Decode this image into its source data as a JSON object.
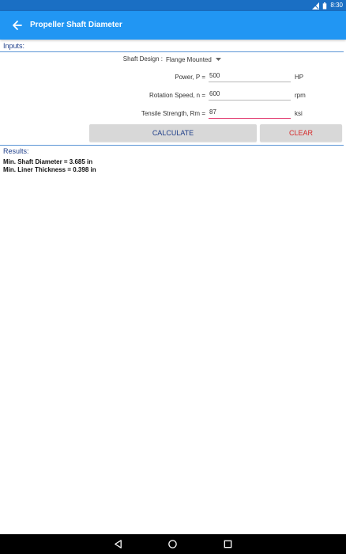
{
  "status": {
    "time": "8:30"
  },
  "appbar": {
    "title": "Propeller Shaft Diameter"
  },
  "inputs": {
    "label": "Inputs:",
    "shaft_design": {
      "label": "Shaft Design :",
      "value": "Flange Mounted"
    },
    "power": {
      "label": "Power, P =",
      "value": "500",
      "unit": "HP"
    },
    "rotation": {
      "label": "Rotation Speed, n =",
      "value": "600",
      "unit": "rpm"
    },
    "tensile": {
      "label": "Tensile Strength, Rm =",
      "value": "87",
      "unit": "ksi"
    }
  },
  "buttons": {
    "calculate": "CALCULATE",
    "clear": "CLEAR"
  },
  "results": {
    "label": "Results:",
    "line1": "Min. Shaft Diameter = 3.685 in",
    "line2": "Min. Liner Thickness = 0.398 in"
  },
  "colors": {
    "appbar": "#2196f3",
    "statusbar": "#1a6fc4",
    "accent": "#e0356b",
    "clear": "#d62a2a",
    "label": "#1f3f8a"
  },
  "icons": {
    "back": "arrow-back-icon",
    "dropdown": "dropdown-caret-icon"
  }
}
